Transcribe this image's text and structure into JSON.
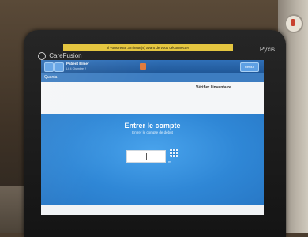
{
  "device": {
    "brand": "CareFusion",
    "model": "Pyxis"
  },
  "alert_strip": "Il vous reste 3 minute(s) avant de vous déconnecter",
  "header": {
    "user_name": "Patient Elmer",
    "user_sub": "Lit 4 Chambre 2",
    "button_label": "Retour"
  },
  "subbar": {
    "title": "Quanta"
  },
  "info": {
    "col1_lines": [
      "",
      "",
      "",
      ""
    ],
    "fields": [
      {
        "label": "",
        "value": ""
      },
      {
        "label": "",
        "value": ""
      }
    ],
    "title": "Vérifier l'inventaire",
    "link": ""
  },
  "prompt": {
    "title": "Entrer le compte",
    "subtitle": "Entrer le compte de début",
    "input_value": "",
    "unit": "ml"
  },
  "footer": {
    "text": ""
  }
}
